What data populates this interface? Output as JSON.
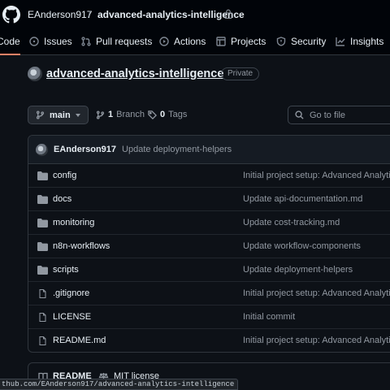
{
  "header": {
    "owner": "EAnderson917",
    "separator": "/",
    "repo": "advanced-analytics-intelligence"
  },
  "tabs": [
    {
      "label": "Code",
      "active": true
    },
    {
      "label": "Issues"
    },
    {
      "label": "Pull requests"
    },
    {
      "label": "Actions"
    },
    {
      "label": "Projects"
    },
    {
      "label": "Security"
    },
    {
      "label": "Insights"
    }
  ],
  "repo": {
    "title": "advanced-analytics-intelligence",
    "visibility": "Private"
  },
  "toolbar": {
    "branch": "main",
    "branch_count": "1",
    "branch_label": "Branch",
    "tag_count": "0",
    "tag_label": "Tags",
    "search_placeholder": "Go to file"
  },
  "latest_commit": {
    "author": "EAnderson917",
    "message": "Update deployment-helpers"
  },
  "files": [
    {
      "name": "config",
      "type": "folder",
      "message": "Initial project setup: Advanced Analytics"
    },
    {
      "name": "docs",
      "type": "folder",
      "message": "Update api-documentation.md"
    },
    {
      "name": "monitoring",
      "type": "folder",
      "message": "Update cost-tracking.md"
    },
    {
      "name": "n8n-workflows",
      "type": "folder",
      "message": "Update workflow-components"
    },
    {
      "name": "scripts",
      "type": "folder",
      "message": "Update deployment-helpers"
    },
    {
      "name": ".gitignore",
      "type": "file",
      "message": "Initial project setup: Advanced Analytics"
    },
    {
      "name": "LICENSE",
      "type": "file",
      "message": "Initial commit"
    },
    {
      "name": "README.md",
      "type": "file",
      "message": "Initial project setup: Advanced Analytics"
    }
  ],
  "readme_tabs": {
    "readme": "README",
    "license": "MIT license"
  },
  "status_url": "thub.com/EAnderson917/advanced-analytics-intelligence",
  "colors": {
    "background": "#0d1117",
    "header_bg": "#010409",
    "active_tab_underline": "#f78166",
    "folder_icon": "#9198a1"
  }
}
